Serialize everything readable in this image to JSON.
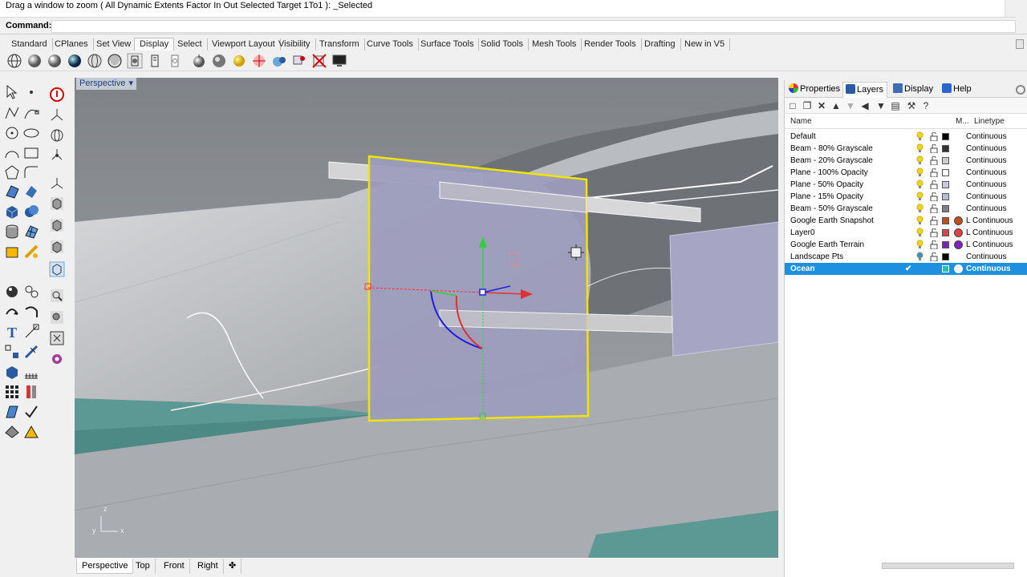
{
  "command": {
    "history": "Drag a window to zoom ( All  Dynamic  Extents  Factor  In  Out  Selected  Target  1To1 ): _Selected",
    "label": "Command:",
    "value": ""
  },
  "tabs": [
    "Standard",
    "CPlanes",
    "Set View",
    "Display",
    "Select",
    "Viewport Layout",
    "Visibility",
    "Transform",
    "Curve Tools",
    "Surface Tools",
    "Solid Tools",
    "Mesh Tools",
    "Render Tools",
    "Drafting",
    "New in V5"
  ],
  "active_tab": "Display",
  "viewport": {
    "title": "Perspective",
    "dropdown": "▾",
    "axis_x": "x",
    "axis_y": "y",
    "axis_z": "z"
  },
  "viewport_tabs": [
    "Perspective",
    "Top",
    "Front",
    "Right"
  ],
  "viewport_add": "✤",
  "panel": {
    "tabs": [
      {
        "label": "Properties",
        "icon": "properties-icon",
        "color": "#c0392b"
      },
      {
        "label": "Layers",
        "icon": "layers-icon",
        "color": "#2c5aa0"
      },
      {
        "label": "Display",
        "icon": "display-icon",
        "color": "#3a6fb5"
      },
      {
        "label": "Help",
        "icon": "help-icon",
        "color": "#2a67c9"
      }
    ],
    "active": "Layers",
    "headers": {
      "name": "Name",
      "material": "M...",
      "linetype": "Linetype"
    }
  },
  "layers": [
    {
      "name": "Default",
      "color": "#000000",
      "mat": "",
      "lt": "Continuous"
    },
    {
      "name": "Beam - 80% Grayscale",
      "color": "#333333",
      "mat": "",
      "lt": "Continuous"
    },
    {
      "name": "Beam - 20% Grayscale",
      "color": "#cccccc",
      "mat": "",
      "lt": "Continuous"
    },
    {
      "name": "Plane - 100% Opacity",
      "color": "#ffffff",
      "mat": "",
      "lt": "Continuous"
    },
    {
      "name": "Plane - 50% Opacity",
      "color": "#c8c8e0",
      "mat": "",
      "lt": "Continuous"
    },
    {
      "name": "Plane - 15% Opacity",
      "color": "#b8b8d8",
      "mat": "",
      "lt": "Continuous"
    },
    {
      "name": "Beam - 50% Grayscale",
      "color": "#7f7f7f",
      "mat": "",
      "lt": "Continuous"
    },
    {
      "name": "Google Earth Snapshot",
      "color": "#c0501a",
      "mat": "#c0501a",
      "lt": "L Continuous"
    },
    {
      "name": "Layer0",
      "color": "#e04040",
      "mat": "#e04040",
      "lt": "L Continuous"
    },
    {
      "name": "Google Earth Terrain",
      "color": "#8020c0",
      "mat": "#8020c0",
      "lt": "L Continuous"
    },
    {
      "name": "Landscape Pts",
      "color": "#000000",
      "mat": "",
      "lt": "Continuous"
    },
    {
      "name": "Ocean",
      "color": "#20c0c0",
      "mat": "#ffffff",
      "lt": "Continuous",
      "selected": true,
      "check": "✔"
    }
  ]
}
